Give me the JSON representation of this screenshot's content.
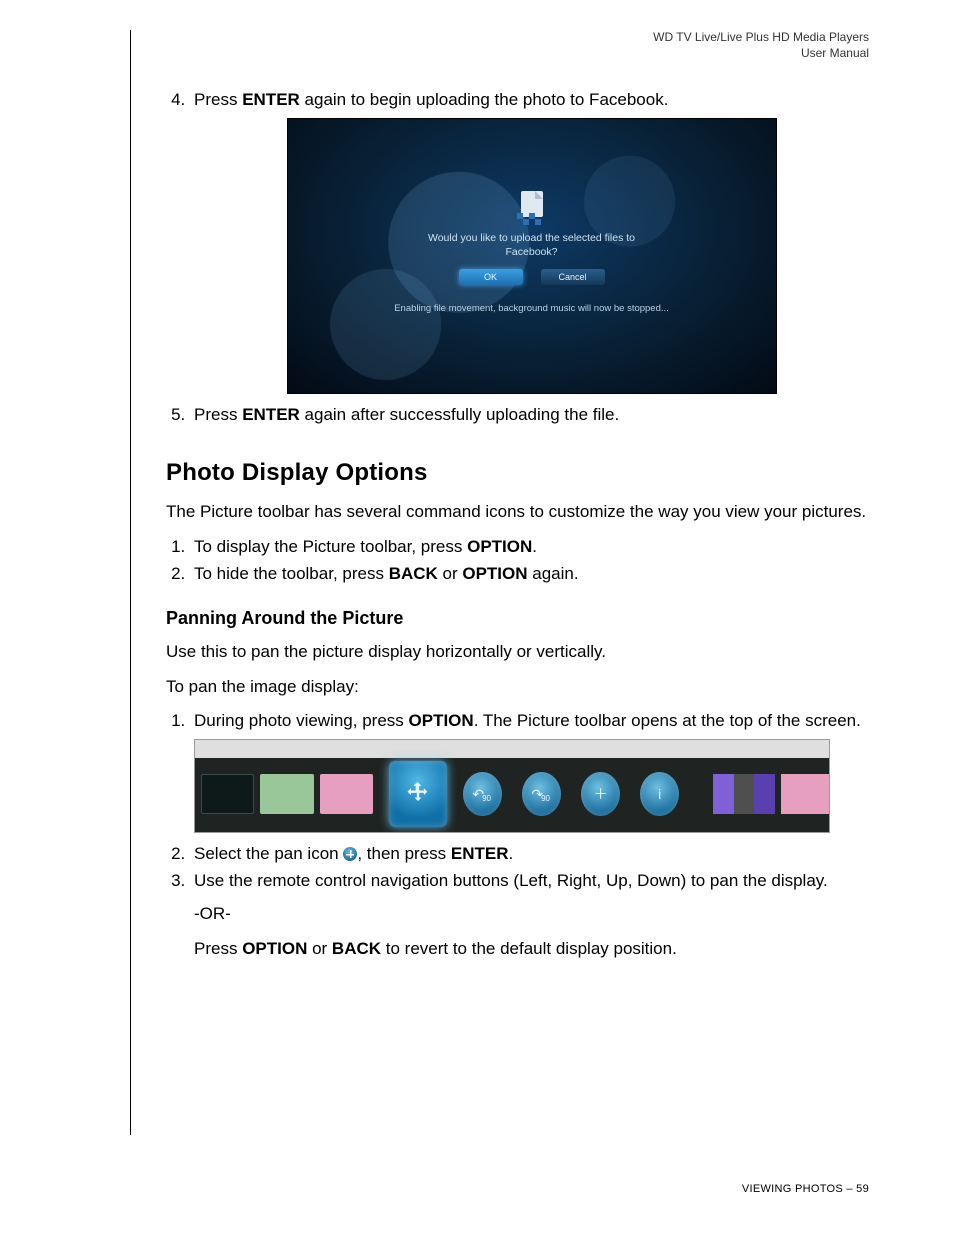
{
  "header": {
    "line1": "WD TV Live/Live Plus HD Media Players",
    "line2": "User Manual"
  },
  "steps_a": {
    "s4_pre": "Press ",
    "s4_key": "ENTER",
    "s4_post": " again to begin uploading the photo to Facebook.",
    "s5_pre": "Press ",
    "s5_key": "ENTER",
    "s5_post": " again after successfully uploading the file."
  },
  "dialog": {
    "question": "Would you like to upload the selected files to Facebook?",
    "ok": "OK",
    "cancel": "Cancel",
    "note": "Enabling file movement, background music will now be stopped..."
  },
  "section": {
    "title": "Photo Display Options",
    "intro": "The Picture toolbar has several command icons to customize the way you view your pictures.",
    "l1_pre": "To display the Picture toolbar, press ",
    "l1_key": "OPTION",
    "l1_post": ".",
    "l2_pre": "To hide the toolbar, press ",
    "l2_k1": "BACK",
    "l2_mid": " or ",
    "l2_k2": "OPTION",
    "l2_post": " again."
  },
  "panning": {
    "title": "Panning Around the Picture",
    "intro": "Use this to pan the picture display horizontally or vertically.",
    "lead": "To pan the image display:",
    "s1_pre": "During photo viewing, press ",
    "s1_key": "OPTION",
    "s1_post": ". The Picture toolbar opens at the top of the screen.",
    "s2_pre": "Select the pan icon ",
    "s2_mid": ", then press ",
    "s2_key": "ENTER",
    "s2_post": ".",
    "s3": "Use the remote control navigation buttons (Left, Right, Up, Down) to pan the display.",
    "or": "-OR-",
    "s3b_pre": "Press ",
    "s3b_k1": "OPTION",
    "s3b_mid": " or ",
    "s3b_k2": "BACK",
    "s3b_post": " to revert to the default display position."
  },
  "footer": {
    "section": "VIEWING PHOTOS",
    "sep": " – ",
    "page": "59"
  }
}
